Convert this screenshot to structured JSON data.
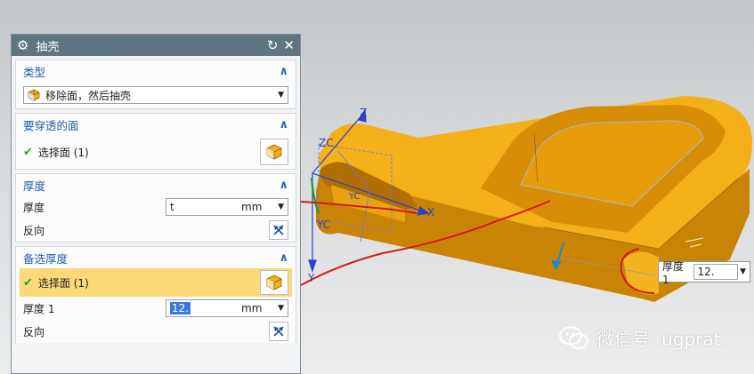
{
  "dialog": {
    "title": "抽壳",
    "reset_icon": "reset-icon",
    "close_icon": "close-icon",
    "type_section": {
      "title": "类型",
      "selected": "移除面，然后抽壳"
    },
    "faces_section": {
      "title": "要穿透的面",
      "select_label": "选择面 (1)"
    },
    "thickness_section": {
      "title": "厚度",
      "thickness_label": "厚度",
      "thickness_value": "t",
      "thickness_unit": "mm",
      "reverse_label": "反向"
    },
    "alt_thickness_section": {
      "title": "备选厚度",
      "select_label": "选择面 (1)",
      "thickness_label": "厚度 1",
      "thickness_value": "12.",
      "thickness_unit": "mm",
      "reverse_label": "反向"
    }
  },
  "viewport": {
    "axis_labels": {
      "z": "Z",
      "zc": "ZC",
      "yc_small": "YC",
      "yc": "YC",
      "x": "X",
      "y": "Y"
    },
    "floating_field": {
      "label": "厚度 1",
      "value": "12."
    }
  },
  "watermark": {
    "text": "微信号: ugprat"
  },
  "colors": {
    "titlebar": "#617580",
    "part": "#f2ae16",
    "highlight": "#fbd97a",
    "annotation": "#d11a1a",
    "section_title": "#2060a8"
  }
}
